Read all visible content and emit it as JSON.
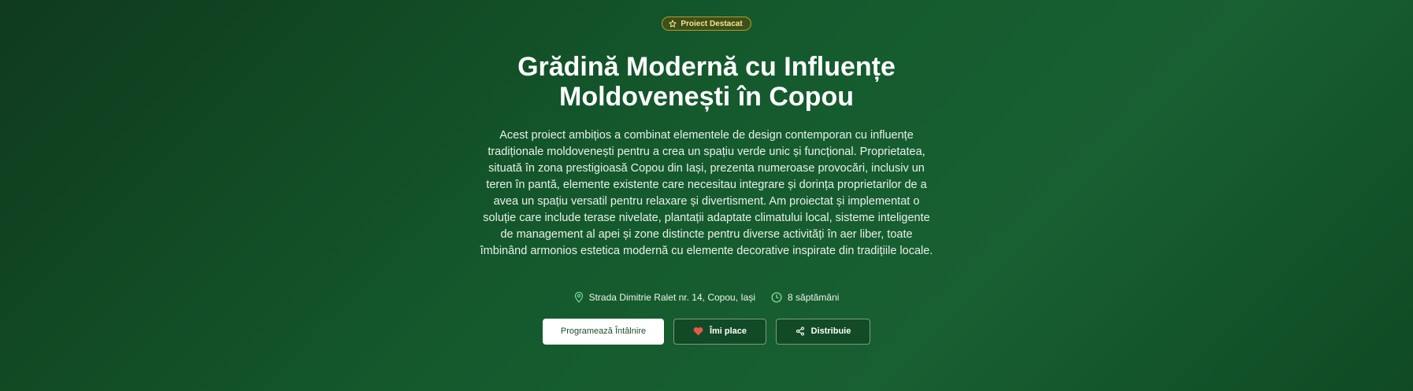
{
  "badge": {
    "icon": "star-icon",
    "label": "Proiect Destacat"
  },
  "title": {
    "line1": "Grădină Modernă cu Influențe",
    "line2": "Moldovenești în Copou"
  },
  "description": "Acest proiect ambițios a combinat elementele de design contemporan cu influențe tradiționale moldovenești pentru a crea un spațiu verde unic și funcțional. Proprietatea, situată în zona prestigioasă Copou din Iași, prezenta numeroase provocări, inclusiv un teren în pantă, elemente existente care necesitau integrare și dorința proprietarilor de a avea un spațiu versatil pentru relaxare și divertisment. Am proiectat și implementat o soluție care include terase nivelate, plantații adaptate climatului local, sisteme inteligente de management al apei și zone distincte pentru diverse activități în aer liber, toate îmbinând armonios estetica modernă cu elemente decorative inspirate din tradițiile locale.",
  "meta": {
    "location": "Strada Dimitrie Ralet nr. 14, Copou, Iași",
    "location_icon": "map-pin-icon",
    "duration": "8 săptămâni",
    "duration_icon": "clock-icon"
  },
  "actions": {
    "primary_label": "Programează Întâlnire",
    "like_label": "Îmi place",
    "like_icon": "heart-icon",
    "share_label": "Distribuie",
    "share_icon": "share-icon"
  },
  "colors": {
    "background_start": "#0f3a1c",
    "background_end": "#185f32",
    "badge_border": "#b6a021",
    "badge_text": "#f6e48b",
    "heart": "#e8574f",
    "icon_accent": "#7fd49a"
  }
}
